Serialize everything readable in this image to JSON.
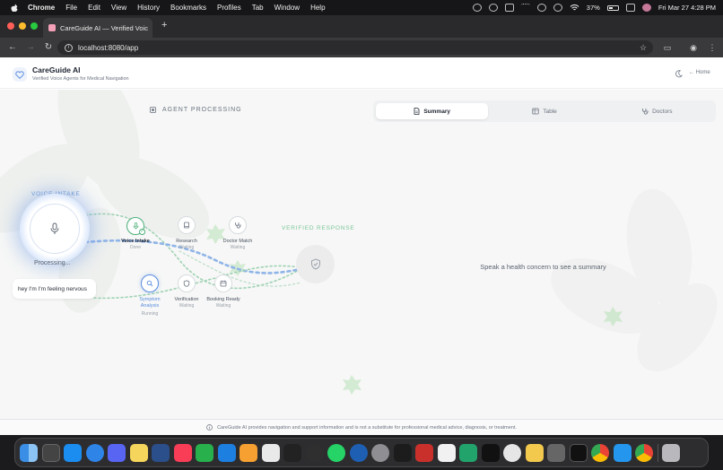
{
  "menubar": {
    "app": "Chrome",
    "items": [
      "File",
      "Edit",
      "View",
      "History",
      "Bookmarks",
      "Profiles",
      "Tab",
      "Window",
      "Help"
    ],
    "battery": "37%",
    "datetime": "Fri Mar 27  4:28 PM"
  },
  "browser": {
    "tab_title": "CareGuide AI — Verified Voic",
    "url": "localhost:8080/app"
  },
  "header": {
    "title": "CareGuide AI",
    "subtitle": "Verified Voice Agents for Medical Navigation",
    "home_label": "Home"
  },
  "agent": {
    "section_title": "AGENT PROCESSING",
    "voice_intake_label": "VOICE INTAKE",
    "processing_label": "Processing...",
    "transcript": "hey I'm I'm feeling nervous",
    "verified_response_label": "VERIFIED RESPONSE",
    "nodes": [
      {
        "name": "Voice Intake",
        "status": "Done"
      },
      {
        "name": "Research",
        "status": "Waiting"
      },
      {
        "name": "Doctor Match",
        "status": "Waiting"
      },
      {
        "name": "Symptom Analysis",
        "status": "Running"
      },
      {
        "name": "Verification",
        "status": "Waiting"
      },
      {
        "name": "Booking Ready",
        "status": "Waiting"
      }
    ]
  },
  "results": {
    "tabs": [
      "Summary",
      "Table",
      "Doctors"
    ],
    "active_tab": "Summary",
    "empty_message": "Speak a health concern to see a summary"
  },
  "footer": {
    "disclaimer": "CareGuide AI provides navigation and support information and is not a substitute for professional medical advice, diagnosis, or treatment."
  },
  "colors": {
    "accent_blue": "#5a8de0",
    "accent_green": "#4caf7a",
    "leaf_green": "#c8e6c8"
  }
}
